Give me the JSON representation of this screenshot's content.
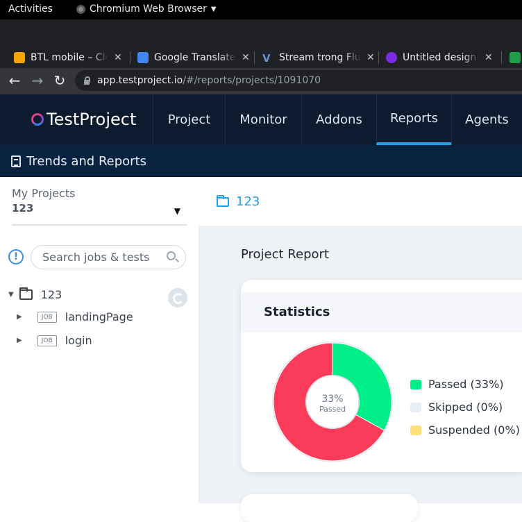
{
  "os": {
    "activities": "Activities",
    "app_name": "Chromium Web Browser"
  },
  "browser": {
    "tabs": [
      {
        "label": "BTL mobile – Cloud",
        "favicon": "firebase-icon",
        "color": "#f6a600"
      },
      {
        "label": "Google Translate",
        "favicon": "translate-icon",
        "color": "#4285f4"
      },
      {
        "label": "Stream trong Flutter",
        "favicon": "v-icon",
        "color": "#6c8cd5"
      },
      {
        "label": "Untitled design - Canva",
        "favicon": "canva-icon",
        "color": "#7d2ae8"
      }
    ],
    "url_host": "app.testproject.io",
    "url_path": "/#/reports/projects/1091070"
  },
  "app": {
    "logo": "TestProject",
    "nav": [
      {
        "label": "Project",
        "active": false
      },
      {
        "label": "Monitor",
        "active": false
      },
      {
        "label": "Addons",
        "active": false
      },
      {
        "label": "Reports",
        "active": true
      },
      {
        "label": "Agents",
        "active": false
      }
    ],
    "subheader": "Trends and Reports"
  },
  "sidebar": {
    "project_label": "My Projects",
    "project_value": "123",
    "search_placeholder": "Search jobs & tests",
    "tree": {
      "root": "123",
      "jobs": [
        {
          "badge": "JOB",
          "name": "landingPage"
        },
        {
          "badge": "JOB",
          "name": "login"
        }
      ]
    }
  },
  "main": {
    "breadcrumb": "123",
    "report_title": "Project Report",
    "statistics": {
      "title": "Statistics",
      "center_value": "33%",
      "center_label": "Passed",
      "legend": [
        {
          "label": "Passed (33%)",
          "color": "#00ee88"
        },
        {
          "label": "Skipped (0%)",
          "color": "#e6eef6"
        },
        {
          "label": "Suspended (0%)",
          "color": "#fde07a"
        }
      ],
      "slices": [
        {
          "name": "passed",
          "value": 33,
          "color": "#00ee88"
        },
        {
          "name": "failed",
          "value": 67,
          "color": "#fa3c5a"
        }
      ]
    }
  }
}
